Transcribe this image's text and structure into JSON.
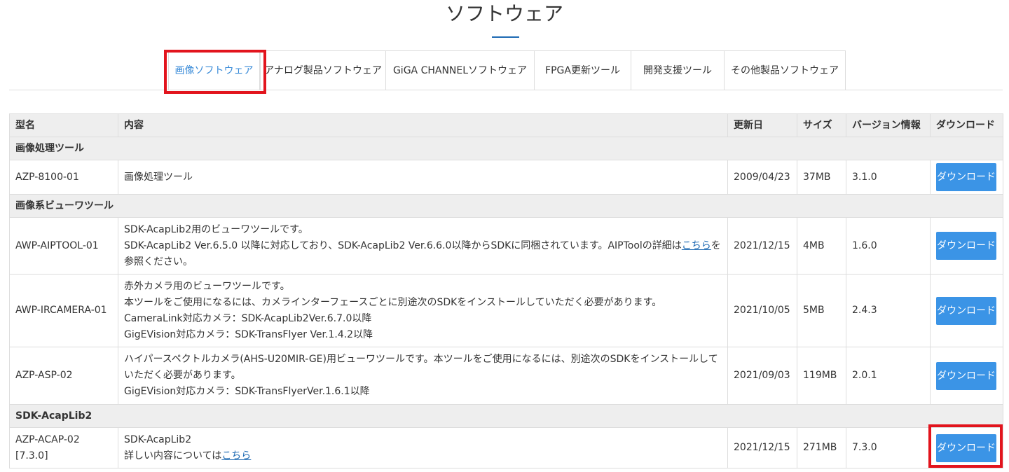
{
  "page": {
    "title": "ソフトウェア"
  },
  "tabs": [
    {
      "label": "画像ソフトウェア",
      "active": true
    },
    {
      "label": "アナログ製品ソフトウェア"
    },
    {
      "label": "GiGA CHANNELソフトウェア"
    },
    {
      "label": "FPGA更新ツール"
    },
    {
      "label": "開発支援ツール"
    },
    {
      "label": "その他製品ソフトウェア"
    }
  ],
  "table": {
    "headers": [
      "型名",
      "内容",
      "更新日",
      "サイズ",
      "バージョン情報",
      "ダウンロード"
    ],
    "groups": [
      {
        "title": "画像処理ツール",
        "rows": [
          {
            "model": "AZP-8100-01",
            "desc": [
              "画像処理ツール"
            ],
            "date": "2009/04/23",
            "size": "37MB",
            "version": "3.1.0",
            "button": "ダウンロード"
          }
        ]
      },
      {
        "title": "画像系ビューワツール",
        "rows": [
          {
            "model": "AWP-AIPTOOL-01",
            "desc": [
              "SDK-AcapLib2用のビューワツールです。",
              "SDK-AcapLib2 Ver.6.5.0 以降に対応しており、SDK-AcapLib2 Ver.6.6.0以降からSDKに同梱されています。AIPToolの詳細は"
            ],
            "link": "こちら",
            "after_link": "を参照ください。",
            "date": "2021/12/15",
            "size": "4MB",
            "version": "1.6.0",
            "button": "ダウンロード"
          },
          {
            "model": "AWP-IRCAMERA-01",
            "desc": [
              "赤外カメラ用のビューワツールです。",
              "本ツールをご使用になるには、カメラインターフェースごとに別途次のSDKをインストールしていただく必要があります。",
              "CameraLink対応カメラ：SDK-AcapLib2Ver.6.7.0以降",
              "GigEVision対応カメラ：SDK-TransFlyer Ver.1.4.2以降"
            ],
            "date": "2021/10/05",
            "size": "5MB",
            "version": "2.4.3",
            "button": "ダウンロード"
          },
          {
            "model": "AZP-ASP-02",
            "desc": [
              "ハイパースペクトルカメラ(AHS-U20MIR-GE)用ビューワツールです。本ツールをご使用になるには、別途次のSDKをインストールしていただく必要があります。",
              "GigEVision対応カメラ：SDK-TransFlyerVer.1.6.1以降"
            ],
            "date": "2021/09/03",
            "size": "119MB",
            "version": "2.0.1",
            "button": "ダウンロード"
          }
        ]
      },
      {
        "title": "SDK-AcapLib2",
        "rows": [
          {
            "model": "AZP-ACAP-02 [7.3.0]",
            "desc": [
              "SDK-AcapLib2",
              "詳しい内容については"
            ],
            "link": "こちら",
            "date": "2021/12/15",
            "size": "271MB",
            "version": "7.3.0",
            "button": "ダウンロード"
          }
        ]
      }
    ]
  },
  "colors": {
    "highlight": "#e2141d",
    "button": "#3b94e6",
    "link": "#1e6ab3",
    "active_tab": "#3a8bd8"
  }
}
